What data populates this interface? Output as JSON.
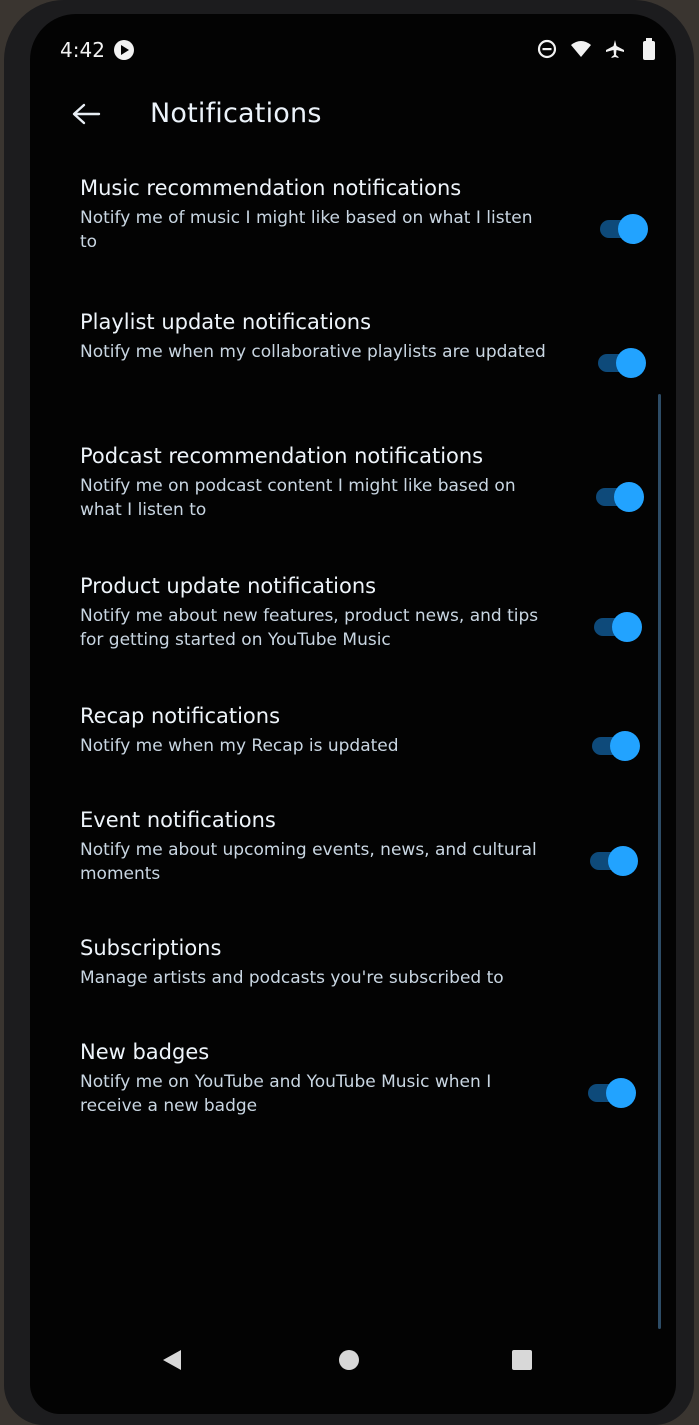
{
  "status_bar": {
    "time": "4:42",
    "icons": [
      "app-notification-icon",
      "do-not-disturb-icon",
      "wifi-icon",
      "airplane-mode-icon",
      "battery-icon"
    ]
  },
  "app_bar": {
    "back_icon": "back-arrow-icon",
    "title": "Notifications"
  },
  "colors": {
    "background": "#030303",
    "toggle_thumb": "#22a3ff",
    "toggle_track": "#0e4a7a",
    "title_text": "#eef4fa",
    "description_text": "#c9d6e2"
  },
  "settings": [
    {
      "title": "Music recommendation notifications",
      "description": "Notify me of music I might like based on what I listen to",
      "toggle": true,
      "enabled": true
    },
    {
      "title": "Playlist update notifications",
      "description": "Notify me when my collaborative playlists are updated",
      "toggle": true,
      "enabled": true
    },
    {
      "title": "Podcast recommendation notifications",
      "description": "Notify me on podcast content I might like based on what I listen to",
      "toggle": true,
      "enabled": true
    },
    {
      "title": "Product update notifications",
      "description": "Notify me about new features, product news, and tips for getting started on YouTube Music",
      "toggle": true,
      "enabled": true
    },
    {
      "title": "Recap notifications",
      "description": "Notify me when my Recap is updated",
      "toggle": true,
      "enabled": true
    },
    {
      "title": "Event notifications",
      "description": "Notify me about upcoming events, news, and cultural moments",
      "toggle": true,
      "enabled": true
    },
    {
      "title": "Subscriptions",
      "description": "Manage artists and podcasts you're subscribed to",
      "toggle": false
    },
    {
      "title": "New badges",
      "description": "Notify me on YouTube and YouTube Music when I receive a new badge",
      "toggle": true,
      "enabled": true
    }
  ],
  "nav_bar": {
    "buttons": [
      "back-triangle-icon",
      "home-circle-icon",
      "recents-square-icon"
    ]
  }
}
